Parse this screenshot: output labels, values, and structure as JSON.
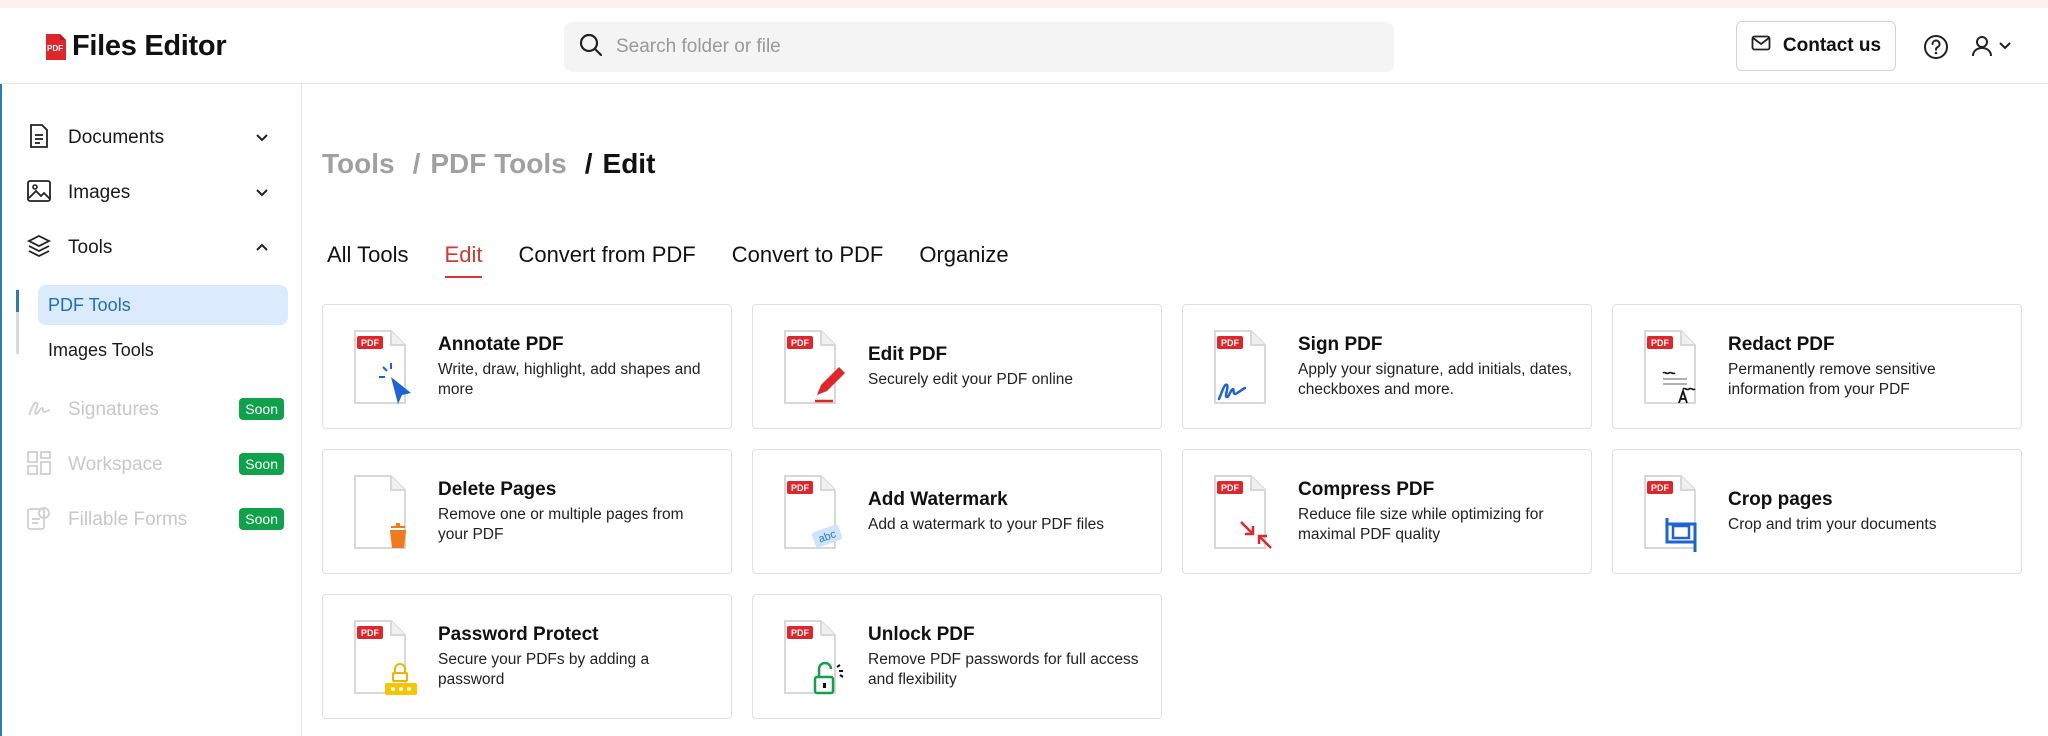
{
  "app": {
    "name": "Files Editor",
    "logo_badge": "PDF"
  },
  "header": {
    "search_placeholder": "Search folder or file",
    "contact_label": "Contact us"
  },
  "sidebar": {
    "items": [
      {
        "label": "Documents",
        "icon": "document-icon",
        "expanded": false
      },
      {
        "label": "Images",
        "icon": "image-icon",
        "expanded": false
      },
      {
        "label": "Tools",
        "icon": "layers-icon",
        "expanded": true
      }
    ],
    "tools_sub": [
      {
        "label": "PDF Tools",
        "active": true
      },
      {
        "label": "Images Tools",
        "active": false
      }
    ],
    "disabled_items": [
      {
        "label": "Signatures",
        "badge": "Soon",
        "icon": "signature-icon"
      },
      {
        "label": "Workspace",
        "badge": "Soon",
        "icon": "workspace-icon"
      },
      {
        "label": "Fillable Forms",
        "badge": "Soon",
        "icon": "forms-icon"
      }
    ]
  },
  "breadcrumb": {
    "items": [
      "Tools",
      "PDF Tools",
      "Edit"
    ],
    "sep": "/"
  },
  "tabs": [
    {
      "label": "All Tools",
      "active": false
    },
    {
      "label": "Edit",
      "active": true
    },
    {
      "label": "Convert from PDF",
      "active": false
    },
    {
      "label": "Convert to PDF",
      "active": false
    },
    {
      "label": "Organize",
      "active": false
    }
  ],
  "cards": [
    {
      "title": "Annotate PDF",
      "desc": "Write, draw, highlight, add shapes and more",
      "icon": "cursor-click-icon"
    },
    {
      "title": "Edit PDF",
      "desc": "Securely edit your PDF online",
      "icon": "pencil-icon"
    },
    {
      "title": "Sign PDF",
      "desc": "Apply your signature, add initials, dates, checkboxes and more.",
      "icon": "signature-icon"
    },
    {
      "title": "Redact PDF",
      "desc": "Permanently remove sensitive information from your PDF",
      "icon": "redact-icon"
    },
    {
      "title": "Delete Pages",
      "desc": "Remove one or multiple pages from your PDF",
      "icon": "trash-icon"
    },
    {
      "title": "Add Watermark",
      "desc": "Add a watermark to your PDF files",
      "icon": "watermark-icon"
    },
    {
      "title": "Compress PDF",
      "desc": "Reduce file size while optimizing for maximal PDF quality",
      "icon": "compress-icon"
    },
    {
      "title": "Crop pages",
      "desc": "Crop and trim your documents",
      "icon": "crop-icon"
    },
    {
      "title": "Password Protect",
      "desc": "Secure your PDFs by adding a password",
      "icon": "password-lock-icon"
    },
    {
      "title": "Unlock PDF",
      "desc": "Remove PDF passwords for full access and flexibility",
      "icon": "unlock-icon"
    }
  ],
  "colors": {
    "accent": "#d9362f",
    "active_blue": "#1f6fbf",
    "soon_green": "#10a24b",
    "pdf_red": "#e0262b"
  }
}
